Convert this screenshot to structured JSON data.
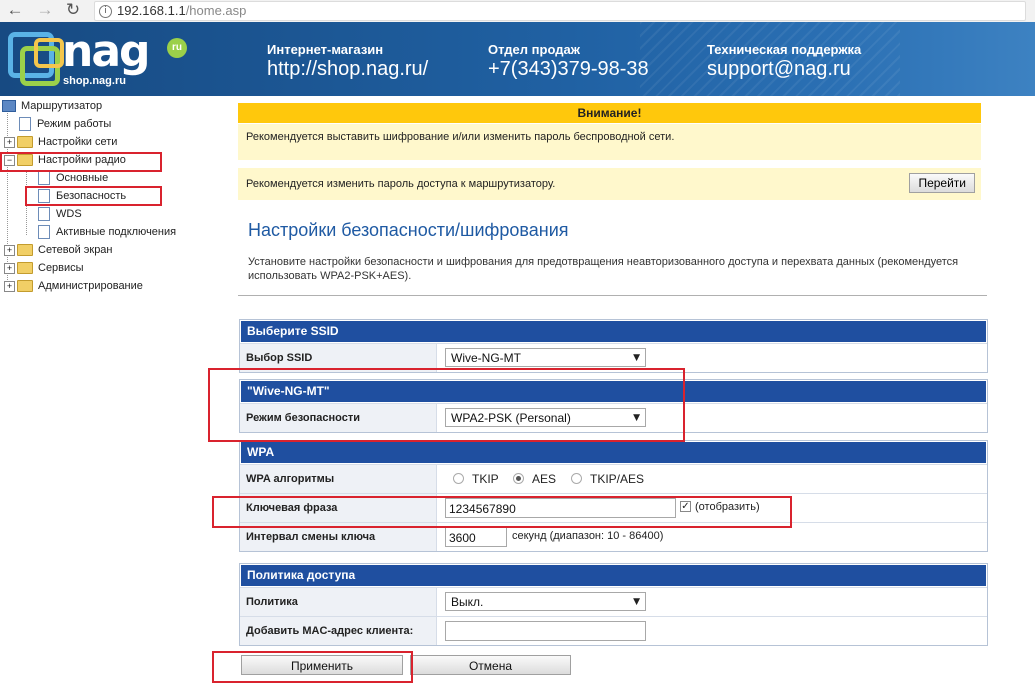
{
  "browser": {
    "url_host": "192.168.1.1",
    "url_path": "/home.asp",
    "back_icon": "←",
    "forward_icon": "→",
    "reload_icon": "↻",
    "info_icon": "i"
  },
  "banner": {
    "logo_word": "nag",
    "logo_ru": "ru",
    "logo_sub": "shop.nag.ru",
    "contacts": [
      {
        "title": "Интернет-магазин",
        "value": "http://shop.nag.ru/"
      },
      {
        "title": "Отдел продаж",
        "value": "+7(343)379-98-38"
      },
      {
        "title": "Техническая поддержка",
        "value": "support@nag.ru"
      }
    ]
  },
  "tree": {
    "root": "Маршрутизатор",
    "items": [
      {
        "label": "Режим работы"
      },
      {
        "label": "Настройки сети"
      },
      {
        "label": "Настройки радио"
      },
      {
        "label": "Основные"
      },
      {
        "label": "Безопасность"
      },
      {
        "label": "WDS"
      },
      {
        "label": "Активные подключения"
      },
      {
        "label": "Сетевой экран"
      },
      {
        "label": "Сервисы"
      },
      {
        "label": "Администрирование"
      }
    ]
  },
  "warning": {
    "title": "Внимание!",
    "msg1": "Рекомендуется выставить шифрование и/или изменить пароль беспроводной сети.",
    "msg2": "Рекомендуется изменить пароль доступа к маршрутизатору.",
    "goto_label": "Перейти"
  },
  "page": {
    "title": "Настройки безопасности/шифрования",
    "desc": "Установите настройки безопасности и шифрования для предотвращения неавторизованного доступа и перехвата данных (рекомендуется использовать WPA2-PSK+AES)."
  },
  "ssid_section": {
    "header": "Выберите SSID",
    "label": "Выбор SSID",
    "value": "Wive-NG-MT"
  },
  "mode_section": {
    "header": "\"Wive-NG-MT\"",
    "label": "Режим безопасности",
    "value": "WPA2-PSK (Personal)"
  },
  "wpa_section": {
    "header": "WPA",
    "algo_label": "WPA алгоритмы",
    "algo_options": [
      "TKIP",
      "AES",
      "TKIP/AES"
    ],
    "algo_selected": "AES",
    "key_label": "Ключевая фраза",
    "key_value": "1234567890",
    "show_label": "(отобразить)",
    "show_checked": true,
    "interval_label": "Интервал смены ключа",
    "interval_value": "3600",
    "interval_hint": "секунд (диапазон: 10 - 86400)"
  },
  "policy_section": {
    "header": "Политика доступа",
    "policy_label": "Политика",
    "policy_value": "Выкл.",
    "mac_label": "Добавить MAC-адрес клиента:",
    "mac_value": ""
  },
  "buttons": {
    "apply": "Применить",
    "cancel": "Отмена"
  },
  "colors": {
    "section_header": "#1f4fa0",
    "warning_header": "#ffc80c",
    "warning_body": "#fff8cc",
    "highlight": "#d9232e",
    "title": "#1f5aa3"
  }
}
